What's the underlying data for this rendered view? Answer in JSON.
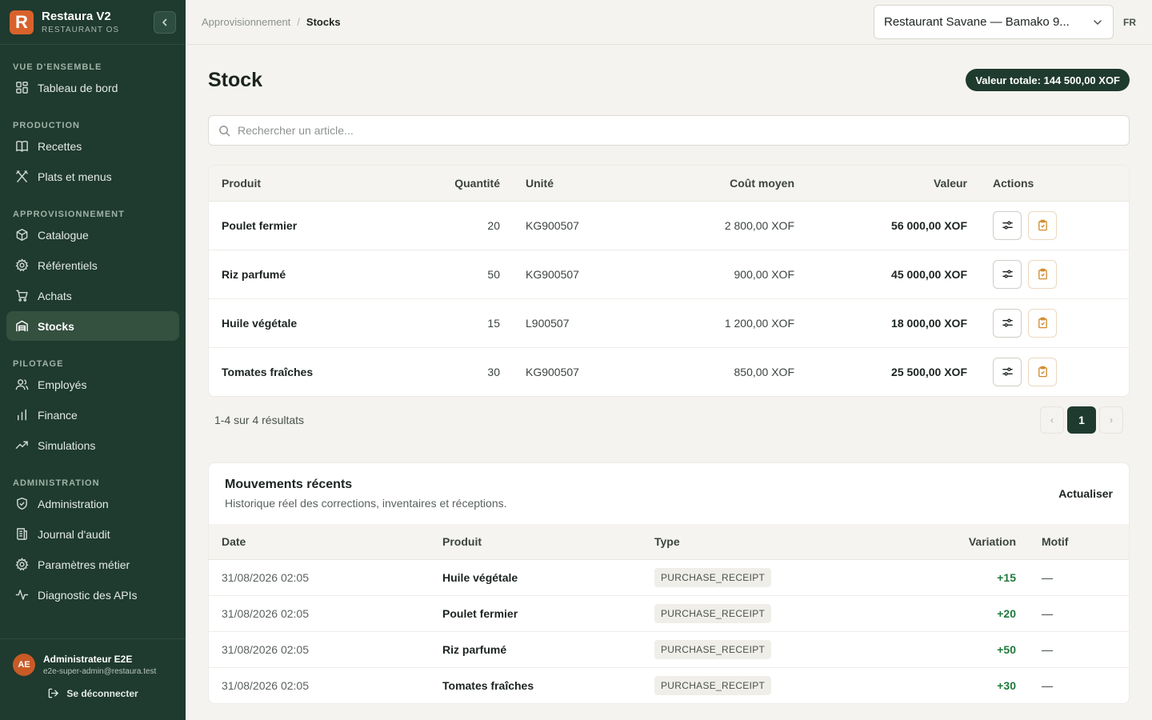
{
  "app": {
    "name": "Restaura V2",
    "subtitle": "RESTAURANT OS",
    "logo_letter": "R"
  },
  "sidebar": {
    "sections": [
      {
        "label": "VUE D'ENSEMBLE",
        "items": [
          {
            "label": "Tableau de bord",
            "icon": "dashboard-icon"
          }
        ]
      },
      {
        "label": "PRODUCTION",
        "items": [
          {
            "label": "Recettes",
            "icon": "book-icon"
          },
          {
            "label": "Plats et menus",
            "icon": "utensils-icon"
          }
        ]
      },
      {
        "label": "APPROVISIONNEMENT",
        "items": [
          {
            "label": "Catalogue",
            "icon": "package-icon"
          },
          {
            "label": "Référentiels",
            "icon": "gear-icon"
          },
          {
            "label": "Achats",
            "icon": "cart-icon"
          },
          {
            "label": "Stocks",
            "icon": "warehouse-icon",
            "active": true
          }
        ]
      },
      {
        "label": "PILOTAGE",
        "items": [
          {
            "label": "Employés",
            "icon": "users-icon"
          },
          {
            "label": "Finance",
            "icon": "bar-chart-icon"
          },
          {
            "label": "Simulations",
            "icon": "trending-icon"
          }
        ]
      },
      {
        "label": "ADMINISTRATION",
        "items": [
          {
            "label": "Administration",
            "icon": "shield-icon"
          },
          {
            "label": "Journal d'audit",
            "icon": "log-icon"
          },
          {
            "label": "Paramètres métier",
            "icon": "gear-icon"
          },
          {
            "label": "Diagnostic des APIs",
            "icon": "pulse-icon"
          }
        ]
      }
    ],
    "user": {
      "initials": "AE",
      "name": "Administrateur E2E",
      "email": "e2e-super-admin@restaura.test"
    },
    "logout_label": "Se déconnecter"
  },
  "topbar": {
    "breadcrumb": [
      "Approvisionnement",
      "Stocks"
    ],
    "restaurant": "Restaurant Savane — Bamako 9...",
    "lang": "FR"
  },
  "page": {
    "title": "Stock",
    "total_value": "Valeur totale: 144 500,00 XOF",
    "search_placeholder": "Rechercher un article..."
  },
  "stock_table": {
    "headers": [
      "Produit",
      "Quantité",
      "Unité",
      "Coût moyen",
      "Valeur",
      "Actions"
    ],
    "rows": [
      {
        "product": "Poulet fermier",
        "qty": "20",
        "unit": "KG900507",
        "avg_cost": "2 800,00 XOF",
        "value": "56 000,00 XOF"
      },
      {
        "product": "Riz parfumé",
        "qty": "50",
        "unit": "KG900507",
        "avg_cost": "900,00 XOF",
        "value": "45 000,00 XOF"
      },
      {
        "product": "Huile végétale",
        "qty": "15",
        "unit": "L900507",
        "avg_cost": "1 200,00 XOF",
        "value": "18 000,00 XOF"
      },
      {
        "product": "Tomates fraîches",
        "qty": "30",
        "unit": "KG900507",
        "avg_cost": "850,00 XOF",
        "value": "25 500,00 XOF"
      }
    ]
  },
  "pagination": {
    "results": "1-4 sur 4 résultats",
    "prev": "‹",
    "page": "1",
    "next": "›"
  },
  "movements": {
    "title": "Mouvements récents",
    "subtitle": "Historique réel des corrections, inventaires et réceptions.",
    "refresh_label": "Actualiser",
    "headers": [
      "Date",
      "Produit",
      "Type",
      "Variation",
      "Motif"
    ],
    "rows": [
      {
        "date": "31/08/2026 02:05",
        "product": "Huile végétale",
        "type": "PURCHASE_RECEIPT",
        "variation": "+15",
        "motif": "—"
      },
      {
        "date": "31/08/2026 02:05",
        "product": "Poulet fermier",
        "type": "PURCHASE_RECEIPT",
        "variation": "+20",
        "motif": "—"
      },
      {
        "date": "31/08/2026 02:05",
        "product": "Riz parfumé",
        "type": "PURCHASE_RECEIPT",
        "variation": "+50",
        "motif": "—"
      },
      {
        "date": "31/08/2026 02:05",
        "product": "Tomates fraîches",
        "type": "PURCHASE_RECEIPT",
        "variation": "+30",
        "motif": "—"
      }
    ]
  },
  "colors": {
    "sidebar_bg": "#1f3a2f",
    "accent_orange": "#d9622b",
    "positive": "#1e7a3b"
  }
}
